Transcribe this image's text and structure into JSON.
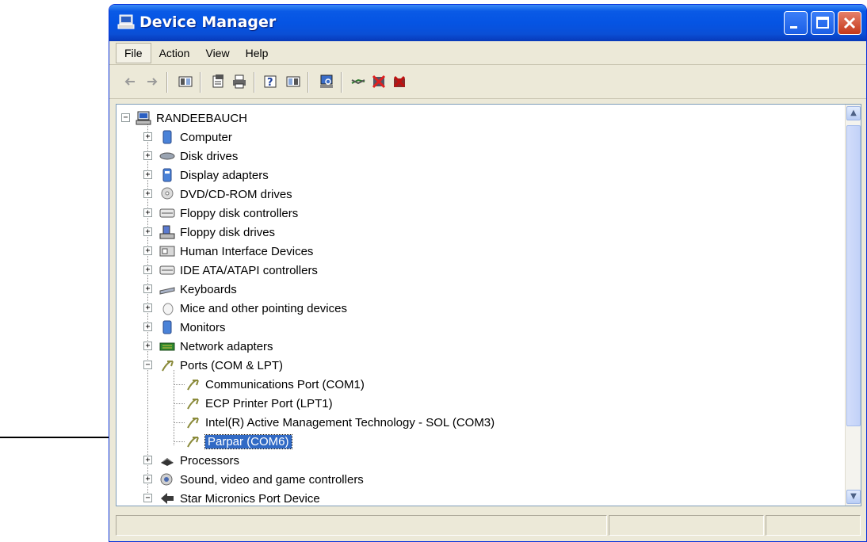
{
  "window": {
    "title": "Device Manager"
  },
  "menu": [
    {
      "label": "File"
    },
    {
      "label": "Action"
    },
    {
      "label": "View"
    },
    {
      "label": "Help"
    }
  ],
  "tree": {
    "root": "RANDEEBAUCH",
    "categories": [
      {
        "label": "Computer",
        "icon": "computer-icon"
      },
      {
        "label": "Disk drives",
        "icon": "disk-drive-icon"
      },
      {
        "label": "Display adapters",
        "icon": "display-adapter-icon"
      },
      {
        "label": "DVD/CD-ROM drives",
        "icon": "dvd-drive-icon"
      },
      {
        "label": "Floppy disk controllers",
        "icon": "floppy-controller-icon"
      },
      {
        "label": "Floppy disk drives",
        "icon": "floppy-drive-icon"
      },
      {
        "label": "Human Interface Devices",
        "icon": "hid-icon"
      },
      {
        "label": "IDE ATA/ATAPI controllers",
        "icon": "ide-controller-icon"
      },
      {
        "label": "Keyboards",
        "icon": "keyboard-icon"
      },
      {
        "label": "Mice and other pointing devices",
        "icon": "mouse-icon"
      },
      {
        "label": "Monitors",
        "icon": "monitor-icon"
      },
      {
        "label": "Network adapters",
        "icon": "network-adapter-icon"
      },
      {
        "label": "Ports (COM & LPT)",
        "icon": "port-icon"
      }
    ],
    "ports": [
      {
        "label": "Communications Port (COM1)"
      },
      {
        "label": "ECP Printer Port (LPT1)"
      },
      {
        "label": "Intel(R) Active Management Technology - SOL (COM3)"
      },
      {
        "label": "Parpar (COM6)"
      }
    ],
    "after": [
      {
        "label": "Processors",
        "icon": "processor-icon"
      },
      {
        "label": "Sound, video and game controllers",
        "icon": "sound-icon"
      },
      {
        "label": "Star Micronics Port Device",
        "icon": "star-port-icon"
      }
    ]
  },
  "colors": {
    "titlebar": "#0554e3",
    "selection": "#316ac5"
  }
}
